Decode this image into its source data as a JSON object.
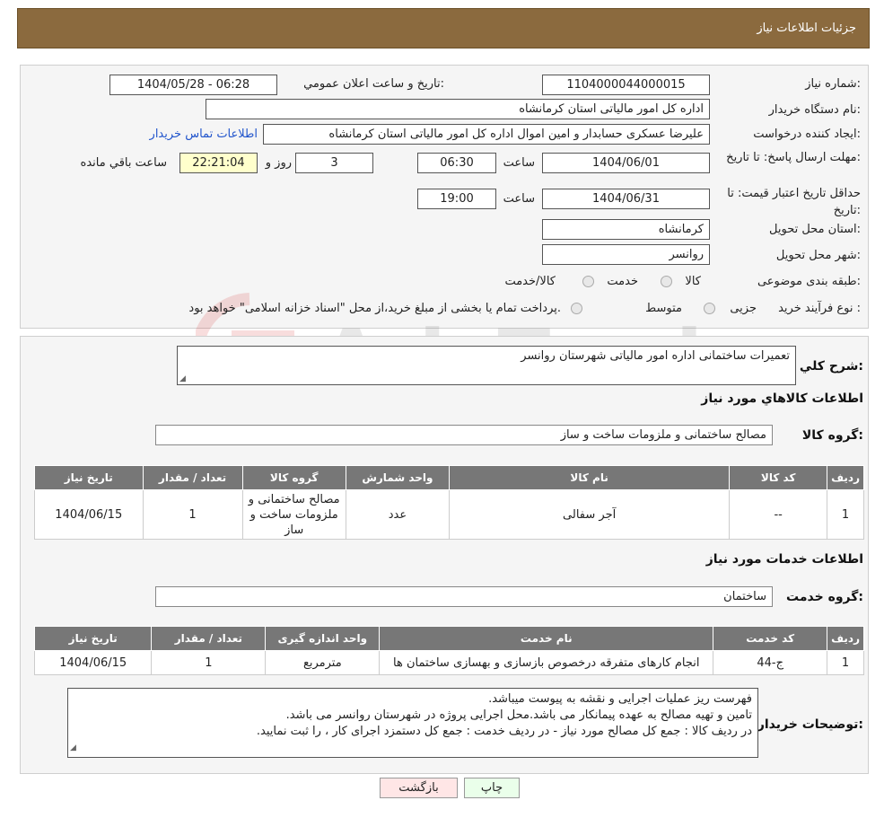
{
  "header": {
    "title": "جزئیات اطلاعات نیاز"
  },
  "need": {
    "number_label": "شماره نیاز:",
    "number": "1104000044000015",
    "announce_label": "تاریخ و ساعت اعلان عمومي:",
    "announce_value": "1404/05/28 - 06:28",
    "buyer_label": "نام دستگاه خریدار:",
    "buyer": "اداره کل امور مالياتی استان کرمانشاه",
    "creator_label": "ایجاد کننده درخواست:",
    "creator": "علیرضا عسکری حسابدار و امین اموال اداره کل امور مالياتی استان کرمانشاه",
    "contact_link": "اطلاعات تماس خریدار",
    "deadline_label": "مهلت ارسال پاسخ: تا تاریخ:",
    "deadline_date": "1404/06/01",
    "time_label": "ساعت",
    "deadline_time": "06:30",
    "days": "3",
    "days_label": "روز و",
    "remaining": "22:21:04",
    "remaining_label": "ساعت باقي مانده",
    "validity_label": "حداقل تاریخ اعتبار قیمت: تا تاریخ:",
    "validity_date": "1404/06/31",
    "validity_time": "19:00",
    "province_label": "استان محل تحویل:",
    "province": "کرمانشاه",
    "city_label": "شهر محل تحویل:",
    "city": "روانسر",
    "category_label": "طبقه بندی موضوعی:",
    "category_options": [
      "کالا",
      "خدمت",
      "کالا/خدمت"
    ],
    "process_label": "نوع فرآیند خرید :",
    "process_options": [
      "جزیی",
      "متوسط"
    ],
    "payment_note": "پرداخت تمام یا بخشی از مبلغ خرید،از محل \"اسناد خزانه اسلامی\" خواهد بود."
  },
  "summary": {
    "label": "شرح کلي نیاز:",
    "value": "تعمیرات ساختمانی اداره امور مالیاتی شهرستان روانسر"
  },
  "goods": {
    "section_title": "اطلاعات کالاهاي مورد نیاز",
    "group_label": "گروه کالا:",
    "group_value": "مصالح ساختمانی و ملزومات ساخت و ساز",
    "columns": [
      "ردیف",
      "کد کالا",
      "نام کالا",
      "واحد شمارش",
      "گروه کالا",
      "تعداد / مقدار",
      "تاریخ نیاز"
    ],
    "rows": [
      [
        "1",
        "--",
        "آجر سفالی",
        "عدد",
        "مصالح ساختمانی و ملزومات ساخت و ساز",
        "1",
        "1404/06/15"
      ]
    ]
  },
  "services": {
    "section_title": "اطلاعات خدمات مورد نیاز",
    "group_label": "گروه خدمت:",
    "group_value": "ساختمان",
    "columns": [
      "ردیف",
      "کد خدمت",
      "نام خدمت",
      "واحد اندازه گیری",
      "تعداد / مقدار",
      "تاریخ نیاز"
    ],
    "rows": [
      [
        "1",
        "ج-44",
        "انجام کارهای متفرقه درخصوص بازسازی و بهسازی ساختمان ها",
        "مترمربع",
        "1",
        "1404/06/15"
      ]
    ]
  },
  "buyer_notes": {
    "label": "توضیحات خریدار:",
    "lines": [
      "فهرست ریز عملیات اجرایی و نقشه به پیوست میباشد.",
      "تامین و تهیه مصالح به عهده پیمانکار می باشد.محل اجرایی پروژه در شهرستان روانسر می باشد.",
      "در ردیف کالا : جمع کل مصالح مورد نیاز - در ردیف خدمت : جمع کل دستمزد اجرای کار ، را ثبت نمایید."
    ]
  },
  "buttons": {
    "print": "چاپ",
    "back": "بازگشت"
  },
  "watermark_text": "AriaTender.neT",
  "colors": {
    "header": "#8b6a3e",
    "table_header": "#777777",
    "remaining_bg": "#ffffcc",
    "link": "#2255cc"
  }
}
